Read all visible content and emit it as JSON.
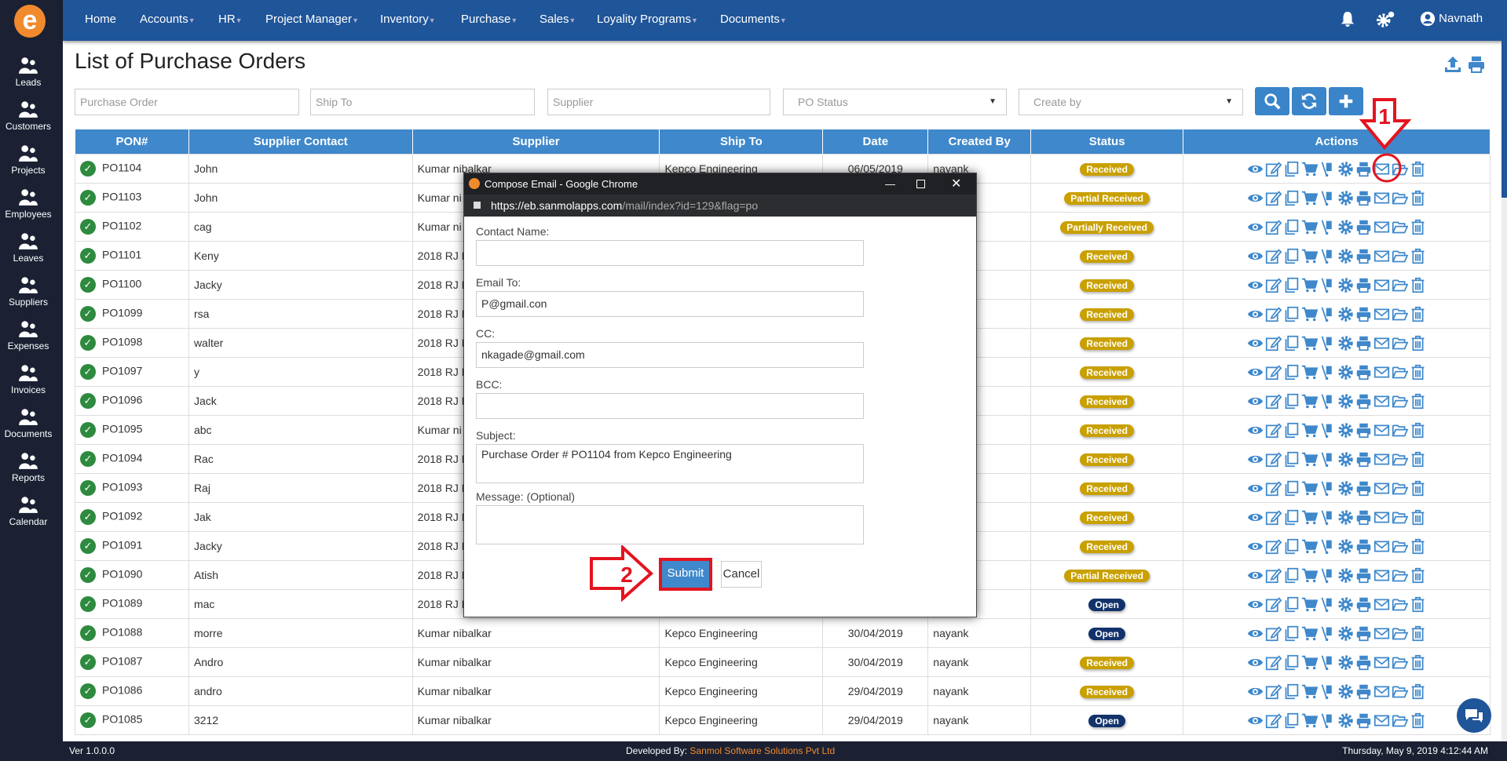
{
  "app": {
    "logo": "e",
    "user": "Navnath"
  },
  "nav": [
    "Home",
    "Accounts",
    "HR",
    "Project Manager",
    "Inventory",
    "Purchase",
    "Sales",
    "Loyality Programs",
    "Documents"
  ],
  "sidebar": [
    "Leads",
    "Customers",
    "Projects",
    "Employees",
    "Leaves",
    "Suppliers",
    "Expenses",
    "Invoices",
    "Documents",
    "Reports",
    "Calendar"
  ],
  "page": {
    "title": "List of Purchase Orders"
  },
  "filters": {
    "purchase_order": "Purchase Order",
    "ship_to": "Ship To",
    "supplier": "Supplier",
    "po_status": "PO Status",
    "create_by": "Create by"
  },
  "table": {
    "headers": [
      "PON#",
      "Supplier Contact",
      "Supplier",
      "Ship To",
      "Date",
      "Created By",
      "Status",
      "Actions"
    ],
    "rows": [
      [
        "PO1104",
        "John",
        "Kumar nibalkar",
        "Kepco Engineering",
        "06/05/2019",
        "nayank",
        "Received"
      ],
      [
        "PO1103",
        "John",
        "Kumar ni",
        "",
        "",
        "nayank",
        "Partial Received"
      ],
      [
        "PO1102",
        "cag",
        "Kumar ni",
        "",
        "",
        "nayank",
        "Partially Received"
      ],
      [
        "PO1101",
        "Keny",
        "2018 RJ M",
        "",
        "",
        "nayank",
        "Received"
      ],
      [
        "PO1100",
        "Jacky",
        "2018 RJ M",
        "",
        "",
        "nayank",
        "Received"
      ],
      [
        "PO1099",
        "rsa",
        "2018 RJ M",
        "",
        "",
        "nayank",
        "Received"
      ],
      [
        "PO1098",
        "walter",
        "2018 RJ M",
        "",
        "",
        "nayank",
        "Received"
      ],
      [
        "PO1097",
        "y",
        "2018 RJ M",
        "",
        "",
        "nayank",
        "Received"
      ],
      [
        "PO1096",
        "Jack",
        "2018 RJ M",
        "",
        "",
        "nayank",
        "Received"
      ],
      [
        "PO1095",
        "abc",
        "Kumar ni",
        "",
        "",
        "nayank",
        "Received"
      ],
      [
        "PO1094",
        "Rac",
        "2018 RJ M",
        "",
        "",
        "nayank",
        "Received"
      ],
      [
        "PO1093",
        "Raj",
        "2018 RJ M",
        "",
        "",
        "nayank",
        "Received"
      ],
      [
        "PO1092",
        "Jak",
        "2018 RJ M",
        "",
        "",
        "nayank",
        "Received"
      ],
      [
        "PO1091",
        "Jacky",
        "2018 RJ M",
        "",
        "",
        "nayank",
        "Received"
      ],
      [
        "PO1090",
        "Atish",
        "2018 RJ M",
        "",
        "",
        "nayank",
        "Partial Received"
      ],
      [
        "PO1089",
        "mac",
        "2018 RJ M",
        "",
        "",
        "nayank",
        "Open"
      ],
      [
        "PO1088",
        "morre",
        "Kumar nibalkar",
        "Kepco Engineering",
        "30/04/2019",
        "nayank",
        "Open"
      ],
      [
        "PO1087",
        "Andro",
        "Kumar nibalkar",
        "Kepco Engineering",
        "30/04/2019",
        "nayank",
        "Received"
      ],
      [
        "PO1086",
        "andro",
        "Kumar nibalkar",
        "Kepco Engineering",
        "29/04/2019",
        "nayank",
        "Received"
      ],
      [
        "PO1085",
        "3212",
        "Kumar nibalkar",
        "Kepco Engineering",
        "29/04/2019",
        "nayank",
        "Open"
      ]
    ],
    "action_icons": [
      "eye-icon",
      "edit-icon",
      "copy-icon",
      "cart-icon",
      "dolly-icon",
      "gear-icon",
      "print-icon",
      "envelope-icon",
      "folder-open-icon",
      "trash-icon"
    ]
  },
  "colors": {
    "received": "#c9a000",
    "open": "#12326b",
    "accent": "#3f88cb",
    "nav": "#1f5599"
  },
  "modal": {
    "title": "Compose Email - Google Chrome",
    "url_host": "https://eb.sanmolapps.com",
    "url_path": "/mail/index?id=129&flag=po",
    "contact_label": "Contact Name:",
    "contact_value": "",
    "email_label": "Email To:",
    "email_value": "P@gmail.con",
    "cc_label": "CC:",
    "cc_value": "nkagade@gmail.com",
    "bcc_label": "BCC:",
    "bcc_value": "",
    "subject_label": "Subject:",
    "subject_value": "Purchase Order # PO1104 from Kepco Engineering",
    "message_label": "Message: (Optional)",
    "message_value": "",
    "submit": "Submit",
    "cancel": "Cancel"
  },
  "annotations": {
    "step1": "1",
    "step2": "2"
  },
  "footer": {
    "version": "Ver 1.0.0.0",
    "dev_label": "Developed By:",
    "dev_name": "Sanmol Software Solutions Pvt Ltd",
    "datetime": "Thursday, May 9, 2019 4:12:44 AM"
  }
}
